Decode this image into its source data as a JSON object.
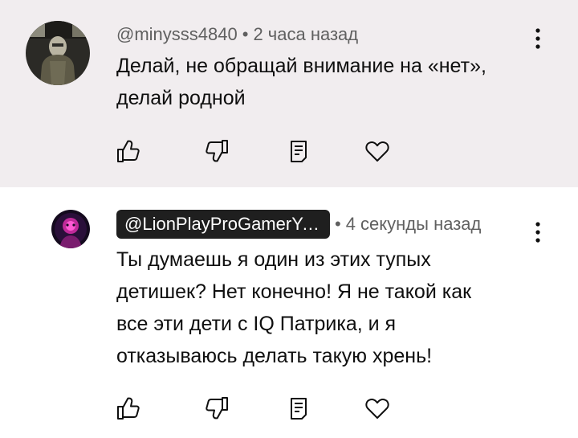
{
  "comments": [
    {
      "author": "@minysss4840",
      "separator": "•",
      "time": "2 часа назад",
      "lines": [
        "Делай, не обращай внимание на «нет»,",
        "делай родной"
      ],
      "author_highlighted": false,
      "background": "#f1edef"
    },
    {
      "author": "@LionPlayProGamerYo...",
      "separator": "•",
      "time": "4 секунды назад",
      "lines": [
        "Ты думаешь я один из этих тупых",
        "детишек? Нет конечно! Я не такой как",
        "все эти дети с IQ Патрика, и я",
        "отказываюсь делать такую хрень!"
      ],
      "author_highlighted": true,
      "background": "#ffffff"
    }
  ],
  "icons": {
    "more": "more-vertical-icon",
    "like": "thumbs-up-icon",
    "dislike": "thumbs-down-icon",
    "reply": "reply-icon",
    "heart": "heart-icon"
  },
  "colors": {
    "text": "#0f0f0f",
    "meta": "#606060",
    "badge": "#1f1f1f",
    "highlight_bg": "#f1edef"
  }
}
